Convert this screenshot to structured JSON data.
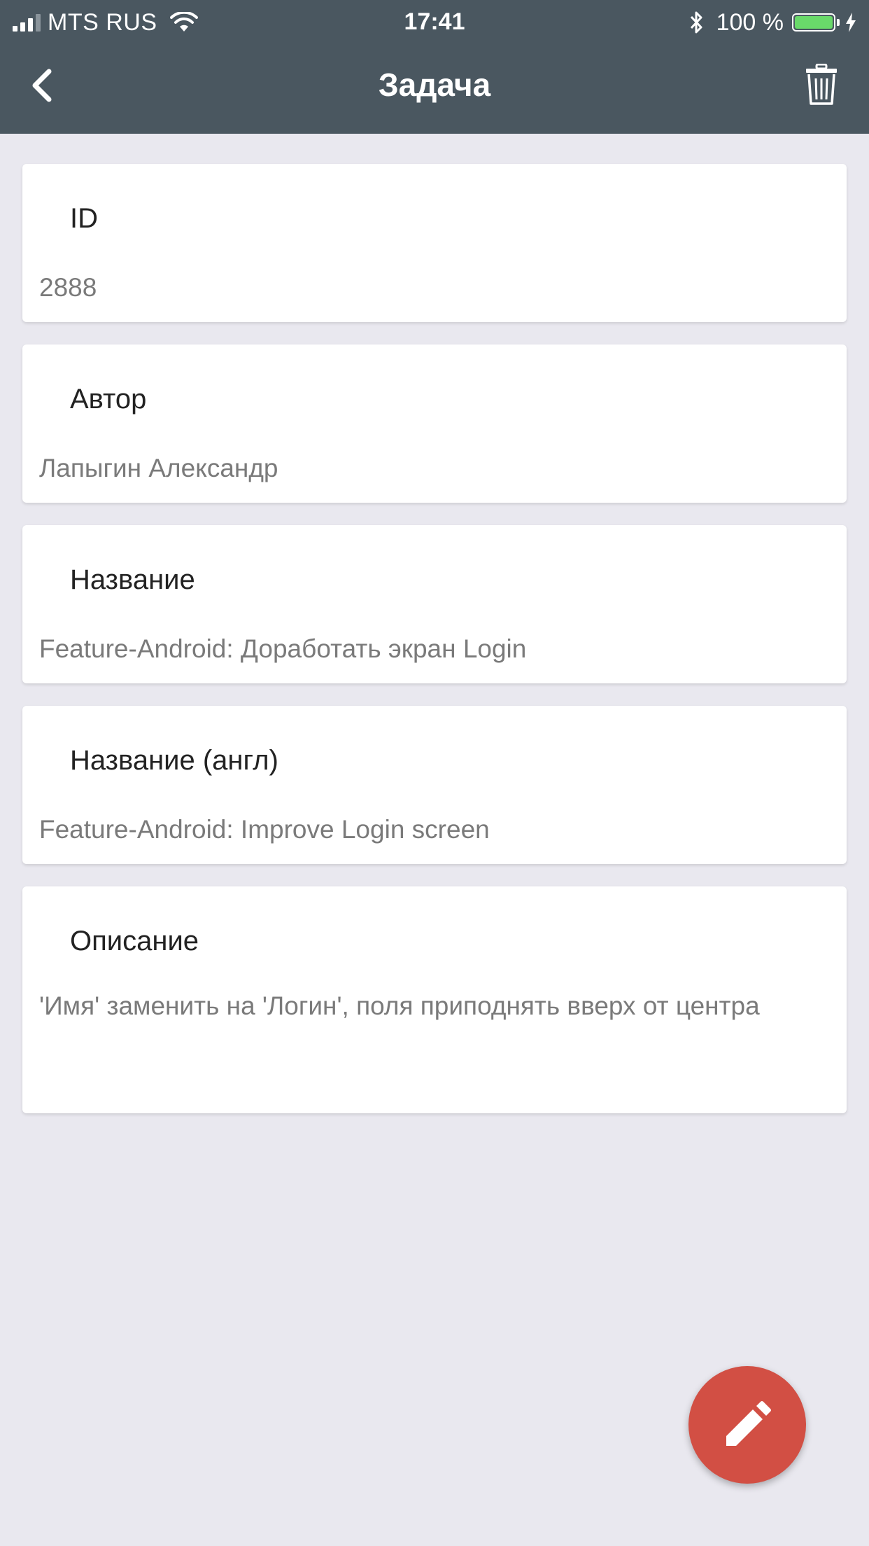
{
  "status_bar": {
    "carrier": "MTS RUS",
    "time": "17:41",
    "battery": "100 %",
    "battery_level": 1.0,
    "icons": [
      "signal-icon",
      "wifi-icon",
      "bluetooth-icon",
      "battery-icon",
      "charging-icon"
    ]
  },
  "nav": {
    "title": "Задача",
    "back_icon": "chevron-left-icon",
    "delete_icon": "trash-icon"
  },
  "fields": [
    {
      "label": "ID",
      "value": "2888"
    },
    {
      "label": "Автор",
      "value": "Лапыгин Александр"
    },
    {
      "label": "Название",
      "value": "Feature-Android: Доработать экран Login"
    },
    {
      "label": "Название (англ)",
      "value": "Feature-Android: Improve Login screen"
    },
    {
      "label": "Описание",
      "value": "'Имя' заменить на 'Логин', поля приподнять вверх от центра"
    }
  ],
  "fab": {
    "icon": "pencil-icon"
  },
  "colors": {
    "header": "#4a5760",
    "background": "#e9e8ef",
    "fab": "#d24f44",
    "battery": "#69d96a"
  }
}
